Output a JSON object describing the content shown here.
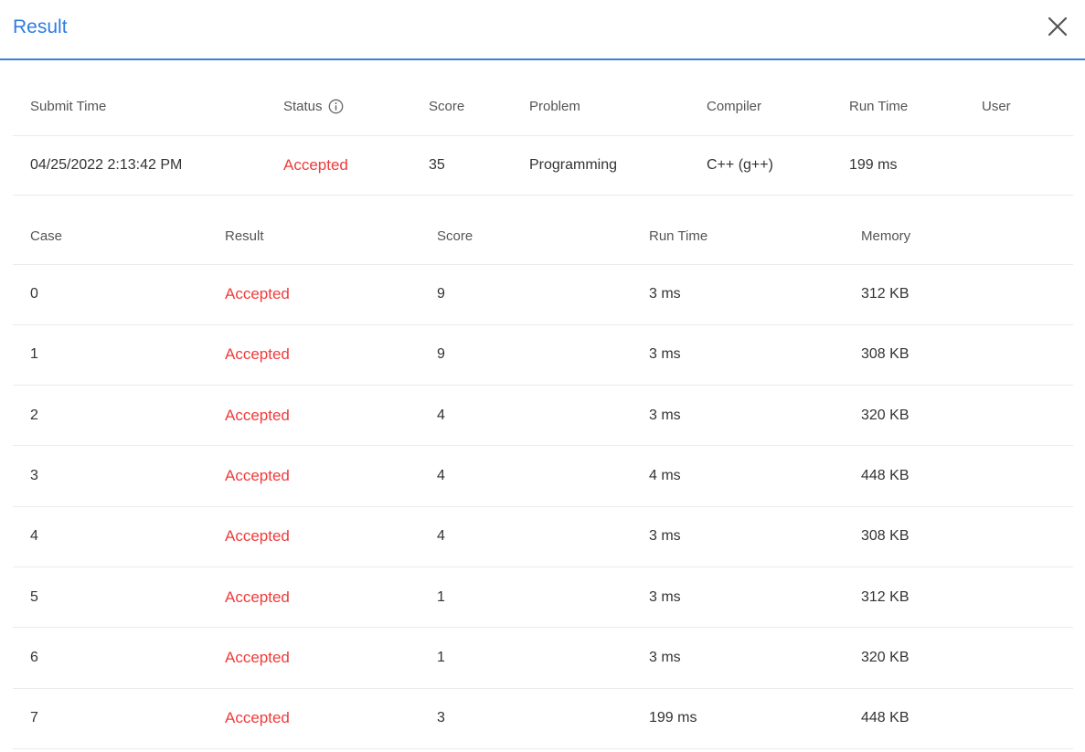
{
  "dialog": {
    "title": "Result"
  },
  "summary": {
    "headers": {
      "submit_time": "Submit Time",
      "status": "Status",
      "score": "Score",
      "problem": "Problem",
      "compiler": "Compiler",
      "run_time": "Run Time",
      "user": "User"
    },
    "row": {
      "submit_time": "04/25/2022 2:13:42 PM",
      "status": "Accepted",
      "score": "35",
      "problem": "Programming",
      "compiler": "C++ (g++)",
      "run_time": "199 ms",
      "user": ""
    }
  },
  "cases": {
    "headers": {
      "case": "Case",
      "result": "Result",
      "score": "Score",
      "run_time": "Run Time",
      "memory": "Memory"
    },
    "rows": [
      {
        "case": "0",
        "result": "Accepted",
        "score": "9",
        "run_time": "3 ms",
        "memory": "312 KB"
      },
      {
        "case": "1",
        "result": "Accepted",
        "score": "9",
        "run_time": "3 ms",
        "memory": "308 KB"
      },
      {
        "case": "2",
        "result": "Accepted",
        "score": "4",
        "run_time": "3 ms",
        "memory": "320 KB"
      },
      {
        "case": "3",
        "result": "Accepted",
        "score": "4",
        "run_time": "4 ms",
        "memory": "448 KB"
      },
      {
        "case": "4",
        "result": "Accepted",
        "score": "4",
        "run_time": "3 ms",
        "memory": "308 KB"
      },
      {
        "case": "5",
        "result": "Accepted",
        "score": "1",
        "run_time": "3 ms",
        "memory": "312 KB"
      },
      {
        "case": "6",
        "result": "Accepted",
        "score": "1",
        "run_time": "3 ms",
        "memory": "320 KB"
      },
      {
        "case": "7",
        "result": "Accepted",
        "score": "3",
        "run_time": "199 ms",
        "memory": "448 KB"
      }
    ]
  },
  "colors": {
    "title": "#2f7be2",
    "accepted": "#ef3b3b",
    "header_rule": "#3b7fd6"
  },
  "icons": {
    "close": "close-icon",
    "status_info": "info-icon"
  }
}
